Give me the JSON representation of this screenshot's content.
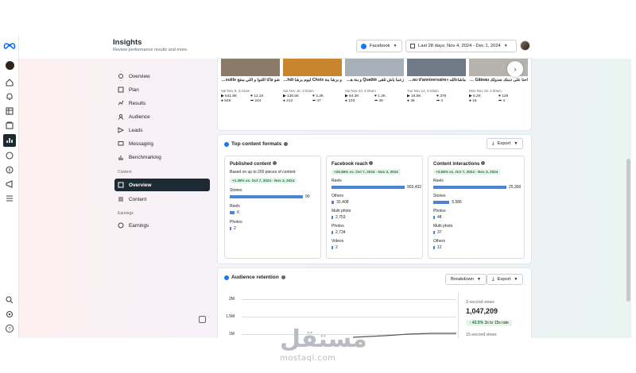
{
  "header": {
    "title": "Insights",
    "subtitle": "Review performance results and more.",
    "platform_select": "Facebook",
    "date_range": "Last 28 days: Nov 4, 2024 - Dec 1, 2024"
  },
  "nav": {
    "items": [
      {
        "label": "Overview",
        "icon": "overview-icon"
      },
      {
        "label": "Plan",
        "icon": "plan-icon"
      },
      {
        "label": "Results",
        "icon": "results-icon"
      },
      {
        "label": "Audience",
        "icon": "audience-icon"
      },
      {
        "label": "Leads",
        "icon": "leads-icon"
      },
      {
        "label": "Messaging",
        "icon": "messaging-icon"
      },
      {
        "label": "Benchmarking",
        "icon": "benchmarking-icon"
      }
    ],
    "section_content": "Content",
    "content_items": [
      {
        "label": "Overview",
        "icon": "content-overview-icon",
        "active": true
      },
      {
        "label": "Content",
        "icon": "content-icon"
      }
    ],
    "section_earnings": "Earnings",
    "earnings_items": [
      {
        "label": "Earnings",
        "icon": "earnings-icon"
      }
    ]
  },
  "posts": [
    {
      "title": "شو فاكا اللنوا و اللي منتج Millefeuille 🤤 لعند",
      "date": "Sat Nov 9, 3:41am",
      "views": "641.6K",
      "reactions": "12.1K",
      "comments": "549",
      "shares": "244",
      "thumb": "#8a7a68"
    },
    {
      "title": "و برشا بنة Choix ليوم برشا Pâtisserie Mahdi عند",
      "date": "Sat Nov 16, 3:02am",
      "views": "136.5K",
      "reactions": "2.3K",
      "comments": "212",
      "shares": "47",
      "thumb": "#c9842e"
    },
    {
      "title": "زعما باش تلقى Qualité و بنة هدي في بلاصة اخرى",
      "date": "Sat Nov 23, 4:05am",
      "views": "84.3K",
      "reactions": "1.2K",
      "comments": "103",
      "shares": "49",
      "thumb": "#a7b0b8"
    },
    {
      "title": "ماشاءالله «Gâteau d'anniversaire » عنا عند",
      "date": "Tue Nov 12, 3:03am",
      "views": "16.5K",
      "reactions": "378",
      "comments": "46",
      "shares": "4",
      "thumb": "#6f7a86"
    },
    {
      "title": "احنا على ذمتك نعدولك Gâteau للفرحة حرة",
      "date": "Mon Nov 18, 2:50am",
      "views": "5.2K",
      "reactions": "129",
      "comments": "16",
      "shares": "4",
      "thumb": "#b6b2ae"
    }
  ],
  "formats": {
    "title": "Top content formats",
    "export": "Export",
    "published": {
      "title": "Published content",
      "desc": "Based on up to 200 pieces of content",
      "badge": "+1.38% vs. Oct 7, 2024 - Nov 3, 2024",
      "rows": [
        {
          "label": "Stories",
          "value": "90",
          "fraction": 1.0
        },
        {
          "label": "Reels",
          "value": "6",
          "fraction": 0.067
        },
        {
          "label": "Photos",
          "value": "2",
          "fraction": 0.022
        }
      ]
    },
    "reach": {
      "title": "Facebook reach",
      "badge": "+26.56% vs. Oct 7, 2024 - Nov 3, 2024",
      "rows": [
        {
          "label": "Reels",
          "value": "903,432",
          "fraction": 1.0
        },
        {
          "label": "Others",
          "value": "31,408",
          "fraction": 0.035
        },
        {
          "label": "Multi photo",
          "value": "2,753",
          "fraction": 0.003
        },
        {
          "label": "Photos",
          "value": "2,734",
          "fraction": 0.003
        },
        {
          "label": "Videos",
          "value": "2",
          "fraction": 0.001
        }
      ]
    },
    "interactions": {
      "title": "Content interactions",
      "badge": "+3.55% vs. Oct 7, 2024 - Nov 3, 2024",
      "rows": [
        {
          "label": "Reels",
          "value": "25,300",
          "fraction": 1.0
        },
        {
          "label": "Stories",
          "value": "5,586",
          "fraction": 0.221
        },
        {
          "label": "Photos",
          "value": "48",
          "fraction": 0.002
        },
        {
          "label": "Multi photo",
          "value": "37",
          "fraction": 0.0015
        },
        {
          "label": "Others",
          "value": "12",
          "fraction": 0.0005
        }
      ]
    }
  },
  "retention": {
    "title": "Audience retention",
    "breakdown": "Breakdown",
    "export": "Export",
    "y_ticks": [
      "2M",
      "1.5M",
      "1M"
    ],
    "stat1_label": "3-second views",
    "stat1_value": "1,047,209",
    "stat1_change": "43.5%",
    "stat1_change_note": "3s to 15s rate",
    "stat2_label": "15-second views"
  },
  "watermark": {
    "arabic": "مستقل",
    "latin": "mostaql.com"
  },
  "colors": {
    "accent": "#1877f2",
    "bar": "#4a84d4",
    "positive": "#1b7a3d",
    "nav_active": "#1c2b33"
  }
}
